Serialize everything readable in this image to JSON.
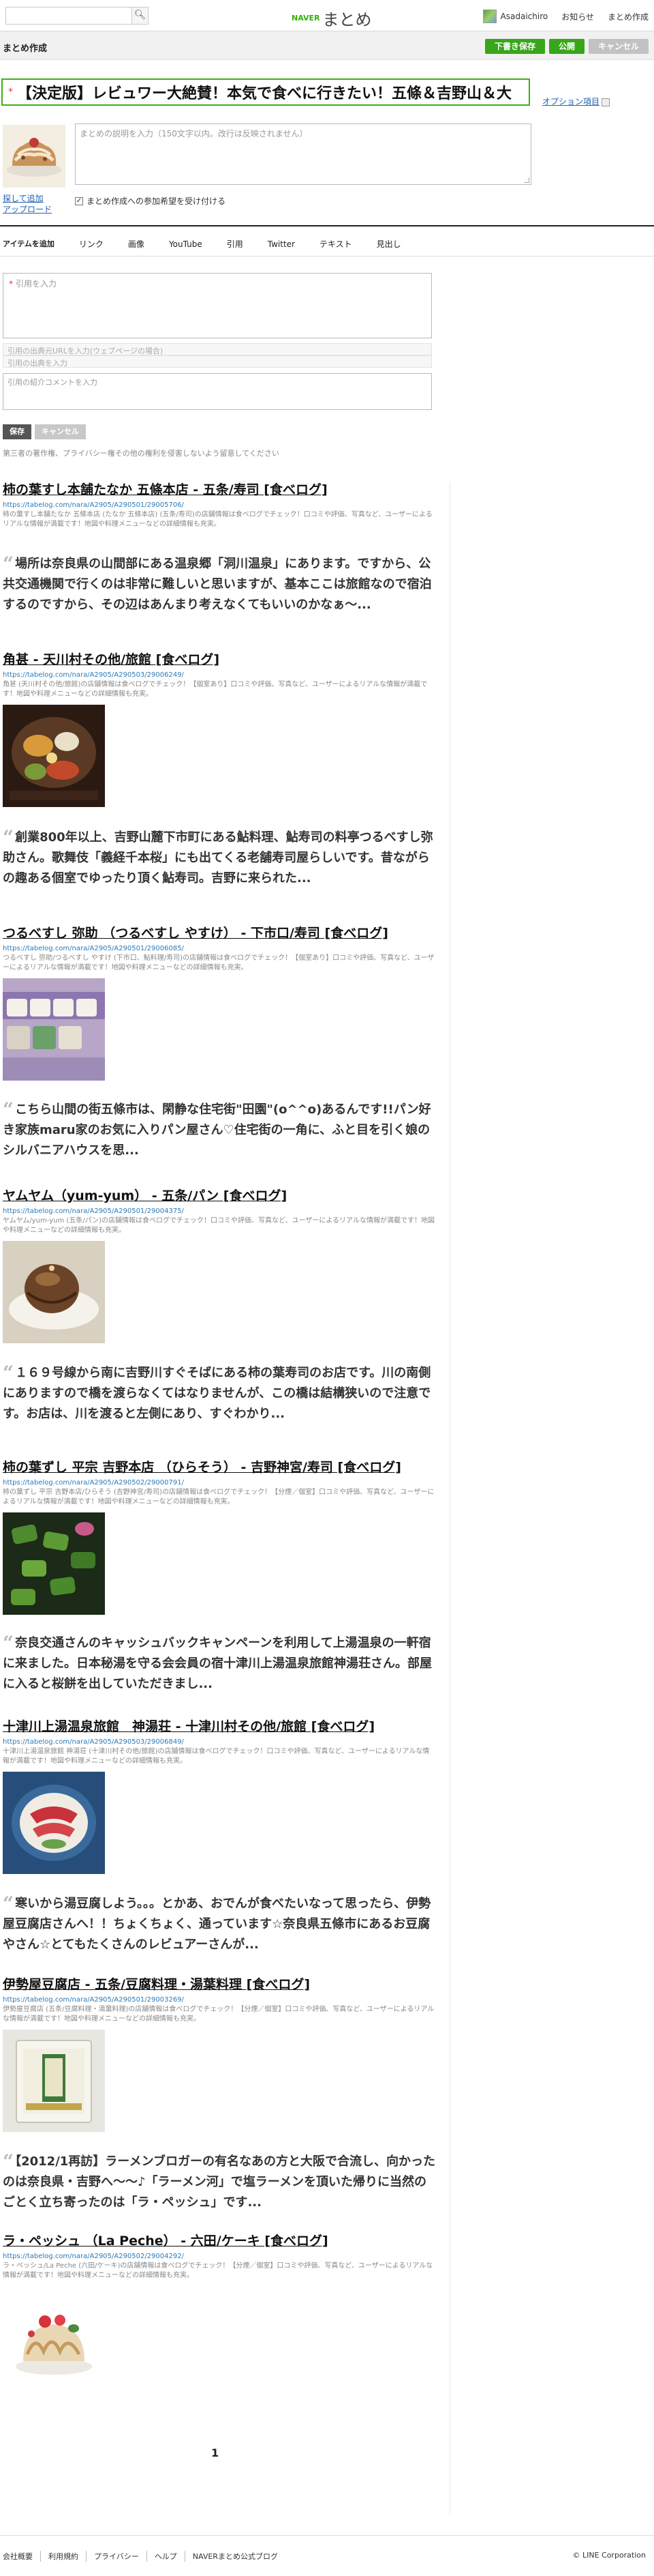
{
  "topbar": {
    "search_placeholder": "",
    "logo_naver": "NAVER",
    "logo_matome": "まとめ",
    "user_name": "Asadaichiro",
    "nav": [
      "お知らせ",
      "まとめ作成"
    ]
  },
  "edit_header": {
    "title": "まとめ作成",
    "buttons": [
      "下書き保存",
      "公開",
      "キャンセル"
    ]
  },
  "form": {
    "title_value": "【決定版】レビュワー大絶賛！本気で食べに行きたい！五條＆吉野山＆大",
    "option_link": "オプション項目",
    "thumb_links": [
      "探して追加",
      "アップロード"
    ],
    "desc_placeholder": "まとめの説明を入力（150文字以内。改行は反映されません）",
    "check_label": "まとめ作成への参加希望を受け付ける"
  },
  "tabs": [
    "アイテムを追加",
    "リンク",
    "画像",
    "YouTube",
    "引用",
    "Twitter",
    "テキスト",
    "見出し"
  ],
  "quote_form": {
    "quote_placeholder": "引用を入力",
    "src_url_placeholder": "引用の出典元URLを入力(ウェブページの場合)",
    "src_title_placeholder": "引用の出典を入力",
    "intro_placeholder": "引用の紹介コメントを入力",
    "save": "保存",
    "cancel": "キャンセル",
    "notice": "第三者の著作権、プライバシー権その他の権利を侵害しないよう留意してください"
  },
  "items": [
    {
      "type": "link",
      "title": "柿の葉すし本舗たなか 五條本店 - 五条/寿司 [食べログ]",
      "url": "https://tabelog.com/nara/A2905/A290501/29005706/",
      "desc": "柿の葉すし本舗たなか 五條本店 (たなか 五條本店) (五条/寿司)の店舗情報は食べログでチェック！口コミや評価、写真など、ユーザーによるリアルな情報が満載です！地図や料理メニューなどの詳細情報も充実。",
      "image": null
    },
    {
      "type": "quote",
      "text": "場所は奈良県の山間部にある温泉郷「洞川温泉」にあります。ですから、公共交通機関で行くのは非常に難しいと思いますが、基本ここは旅館なので宿泊するのですから、その辺はあんまり考えなくてもいいのかなぁ～..."
    },
    {
      "type": "link",
      "title": "角甚 - 天川村その他/旅館 [食べログ]",
      "url": "https://tabelog.com/nara/A2905/A290503/29006249/",
      "desc": "角甚 (天川村その他/旅館)の店舗情報は食べログでチェック！【個室あり】口コミや評価、写真など、ユーザーによるリアルな情報が満載です！地図や料理メニューなどの詳細情報も充実。",
      "image": "kadojin"
    },
    {
      "type": "quote",
      "text": "創業800年以上、吉野山麓下市町にある鮎料理、鮎寿司の料亭つるべすし弥助さん。歌舞伎「義経千本桜」にも出てくる老舗寿司屋らしいです。昔ながらの趣ある個室でゆったり頂く鮎寿司。吉野に来られた..."
    },
    {
      "type": "link",
      "title": "つるべすし 弥助 （つるべすし やすけ） - 下市口/寿司 [食べログ]",
      "url": "https://tabelog.com/nara/A2905/A290501/29006085/",
      "desc": "つるべすし 弥助/つるべすし やすけ (下市口、鮎料理/寿司)の店舗情報は食べログでチェック！【個室あり】口コミや評価、写真など、ユーザーによるリアルな情報が満載です！地図や料理メニューなどの詳細情報も充実。",
      "image": "tsurube"
    },
    {
      "type": "quote",
      "text": "こちら山間の街五條市は、閑静な住宅街\"田園\"(o^^o)あるんです!!パン好き家族maru家のお気に入りパン屋さん♡住宅街の一角に、ふと目を引く娘のシルバニアハウスを思..."
    },
    {
      "type": "link",
      "title": "ヤムヤム（yum-yum） - 五条/パン [食べログ]",
      "url": "https://tabelog.com/nara/A2905/A290501/29004375/",
      "desc": "ヤムヤム/yum-yum (五条/パン)の店舗情報は食べログでチェック！口コミや評価、写真など、ユーザーによるリアルな情報が満載です！地図や料理メニューなどの詳細情報も充実。",
      "image": "yumyum"
    },
    {
      "type": "quote",
      "text": "１６９号線から南に吉野川すぐそばにある柿の葉寿司のお店です。川の南側にありますので橋を渡らなくてはなりませんが、この橋は結構狭いので注意です。お店は、川を渡ると左側にあり、すぐわかり..."
    },
    {
      "type": "link",
      "title": "柿の葉ずし 平宗 吉野本店 （ひらそう） - 吉野神宮/寿司 [食べログ]",
      "url": "https://tabelog.com/nara/A2905/A290502/29000791/",
      "desc": "柿の葉ずし 平宗 吉野本店/ひらそう (吉野神宮/寿司)の店舗情報は食べログでチェック！【分煙／個室】口コミや評価、写真など、ユーザーによるリアルな情報が満載です！地図や料理メニューなどの詳細情報も充実。",
      "image": "hiraso"
    },
    {
      "type": "quote",
      "text": "奈良交通さんのキャッシュバックキャンペーンを利用して上湯温泉の一軒宿に来ました。日本秘湯を守る会会員の宿十津川上湯温泉旅館神湯荘さん。部屋に入ると桜餅を出していただきまし..."
    },
    {
      "type": "link",
      "title": "十津川上湯温泉旅館　神湯荘 - 十津川村その他/旅館 [食べログ]",
      "url": "https://tabelog.com/nara/A2905/A290503/29006849/",
      "desc": "十津川上湯温泉旅館 神湯荘 (十津川村その他/旅館)の店舗情報は食べログでチェック！口コミや評価、写真など、ユーザーによるリアルな情報が満載です！地図や料理メニューなどの詳細情報も充実。",
      "image": "kamiyu"
    },
    {
      "type": "quote",
      "text": "寒いから湯豆腐しよう。。。とかあ、おでんが食べたいなって思ったら、伊勢屋豆腐店さんへ！！ちょくちょく、通っています☆奈良県五條市にあるお豆腐やさん☆とてもたくさんのレビュアーさんが..."
    },
    {
      "type": "link",
      "title": "伊勢屋豆腐店 - 五条/豆腐料理・湯葉料理 [食べログ]",
      "url": "https://tabelog.com/nara/A2905/A290501/29003269/",
      "desc": "伊勢屋豆腐店 (五条/豆腐料理・湯葉料理)の店舗情報は食べログでチェック！【分煙／個室】口コミや評価、写真など、ユーザーによるリアルな情報が満載です！地図や料理メニューなどの詳細情報も充実。",
      "image": "iseya"
    },
    {
      "type": "quote",
      "text": "【2012/1再訪】ラーメンブロガーの有名なあの方と大阪で合流し、向かったのは奈良県・吉野へ～～♪「ラーメン河」で塩ラーメンを頂いた帰りに当然のごとく立ち寄ったのは「ラ・ペッシュ」です..."
    },
    {
      "type": "link",
      "title": "ラ・ペッシュ （La Peche） - 六田/ケーキ [食べログ]",
      "url": "https://tabelog.com/nara/A2905/A290502/29004292/",
      "desc": "ラ・ペッシュ/La Peche (六田/ケーキ)の店舗情報は食べログでチェック！【分煙／個室】口コミや評価、写真など、ユーザーによるリアルな情報が満載です！地図や料理メニューなどの詳細情報も充実。",
      "image": "lapeche"
    }
  ],
  "pagination": {
    "current": "1"
  },
  "footer": {
    "links": [
      "会社概要",
      "利用規約",
      "プライバシー",
      "ヘルプ",
      "NAVERまとめ公式ブログ"
    ],
    "copyright": "© LINE Corporation"
  }
}
